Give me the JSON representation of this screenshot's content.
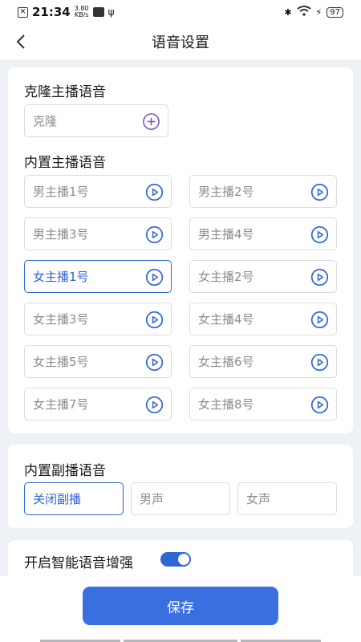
{
  "status_bar": {
    "time": "21:34",
    "net_speed_value": "3.80",
    "net_speed_unit": "KB/s",
    "battery": "97"
  },
  "header": {
    "title": "语音设置"
  },
  "clone": {
    "title": "克隆主播语音",
    "placeholder": "克隆"
  },
  "builtin": {
    "title": "内置主播语音",
    "voices": [
      {
        "label": "男主播1号",
        "selected": false
      },
      {
        "label": "男主播2号",
        "selected": false
      },
      {
        "label": "男主播3号",
        "selected": false
      },
      {
        "label": "男主播4号",
        "selected": false
      },
      {
        "label": "女主播1号",
        "selected": true
      },
      {
        "label": "女主播2号",
        "selected": false
      },
      {
        "label": "女主播3号",
        "selected": false
      },
      {
        "label": "女主播4号",
        "selected": false
      },
      {
        "label": "女主播5号",
        "selected": false
      },
      {
        "label": "女主播6号",
        "selected": false
      },
      {
        "label": "女主播7号",
        "selected": false
      },
      {
        "label": "女主播8号",
        "selected": false
      }
    ]
  },
  "secondary": {
    "title": "内置副播语音",
    "options": [
      {
        "label": "关闭副播",
        "selected": true
      },
      {
        "label": "男声",
        "selected": false
      },
      {
        "label": "女声",
        "selected": false
      }
    ]
  },
  "enhance": {
    "label": "开启智能语音增强",
    "enabled": true
  },
  "footer": {
    "save_label": "保存"
  },
  "colors": {
    "accent": "#2f66d6",
    "button": "#3a6fe0",
    "background": "#eef1f6"
  }
}
